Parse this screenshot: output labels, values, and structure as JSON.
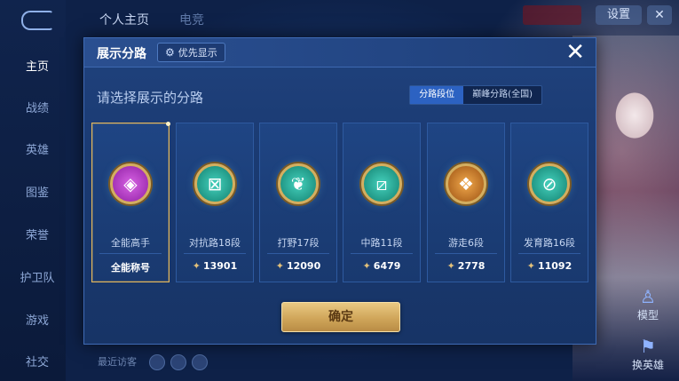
{
  "background": {
    "sidebar": [
      "主页",
      "战绩",
      "英雄",
      "图鉴",
      "荣誉",
      "护卫队",
      "游戏",
      "社交"
    ],
    "top_tabs": [
      "个人主页",
      "电竞"
    ],
    "settings_label": "设置",
    "right_buttons": [
      "模型",
      "换英雄"
    ],
    "recent_visitors": "最近访客"
  },
  "modal": {
    "title": "展示分路",
    "priority_label": "优先显示",
    "subtitle": "请选择展示的分路",
    "segment": {
      "left": "分路段位",
      "right": "巅峰分路(全国)"
    },
    "confirm_label": "确定",
    "cards": [
      {
        "name": "全能高手",
        "score": "全能称号",
        "icon": "allround-emblem-icon",
        "color": "#b736c8",
        "selected": true
      },
      {
        "name": "对抗路18段",
        "score": "13901",
        "icon": "clash-lane-emblem-icon",
        "color": "#1fa59a",
        "selected": false
      },
      {
        "name": "打野17段",
        "score": "12090",
        "icon": "jungle-emblem-icon",
        "color": "#1fa59a",
        "selected": false
      },
      {
        "name": "中路11段",
        "score": "6479",
        "icon": "mid-lane-emblem-icon",
        "color": "#1fa59a",
        "selected": false
      },
      {
        "name": "游走6段",
        "score": "2778",
        "icon": "roam-emblem-icon",
        "color": "#c8782c",
        "selected": false
      },
      {
        "name": "发育路16段",
        "score": "11092",
        "icon": "farm-lane-emblem-icon",
        "color": "#1fa59a",
        "selected": false
      }
    ]
  }
}
